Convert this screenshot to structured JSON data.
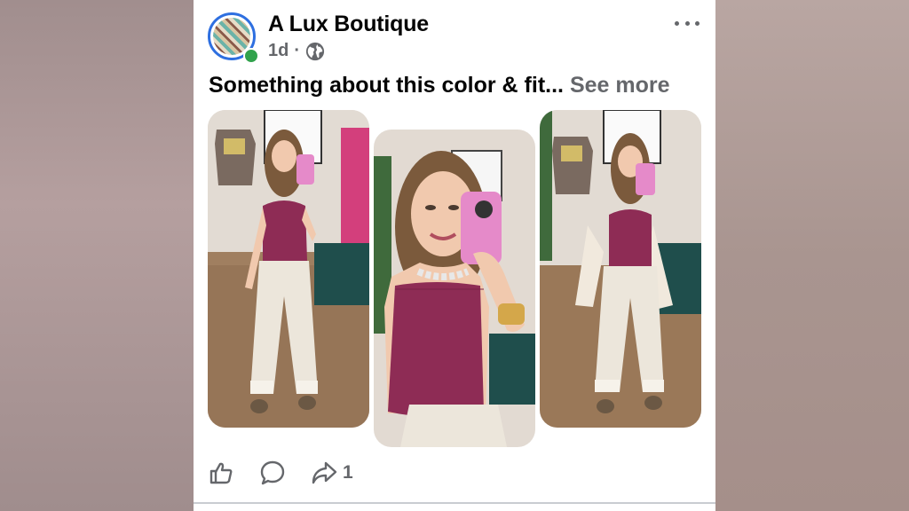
{
  "post": {
    "page_name": "A Lux Boutique",
    "time": "1d",
    "separator": "·",
    "caption": "Something about this color & fit...",
    "see_more": "See more",
    "audience_icon": "globe-icon",
    "menu_icon": "more-horizontal-icon"
  },
  "photos": [
    {
      "name": "photo-1"
    },
    {
      "name": "photo-2"
    },
    {
      "name": "photo-3"
    }
  ],
  "actions": {
    "like_icon": "like-icon",
    "comment_icon": "comment-icon",
    "share_icon": "share-icon",
    "share_count": "1"
  },
  "colors": {
    "text_primary": "#050505",
    "text_secondary": "#65676b",
    "avatar_ring": "#2e6fe0",
    "online": "#31a24c",
    "top_color": "#8e2c55",
    "pants_color": "#ece6db",
    "phone_color": "#e58ac9"
  }
}
